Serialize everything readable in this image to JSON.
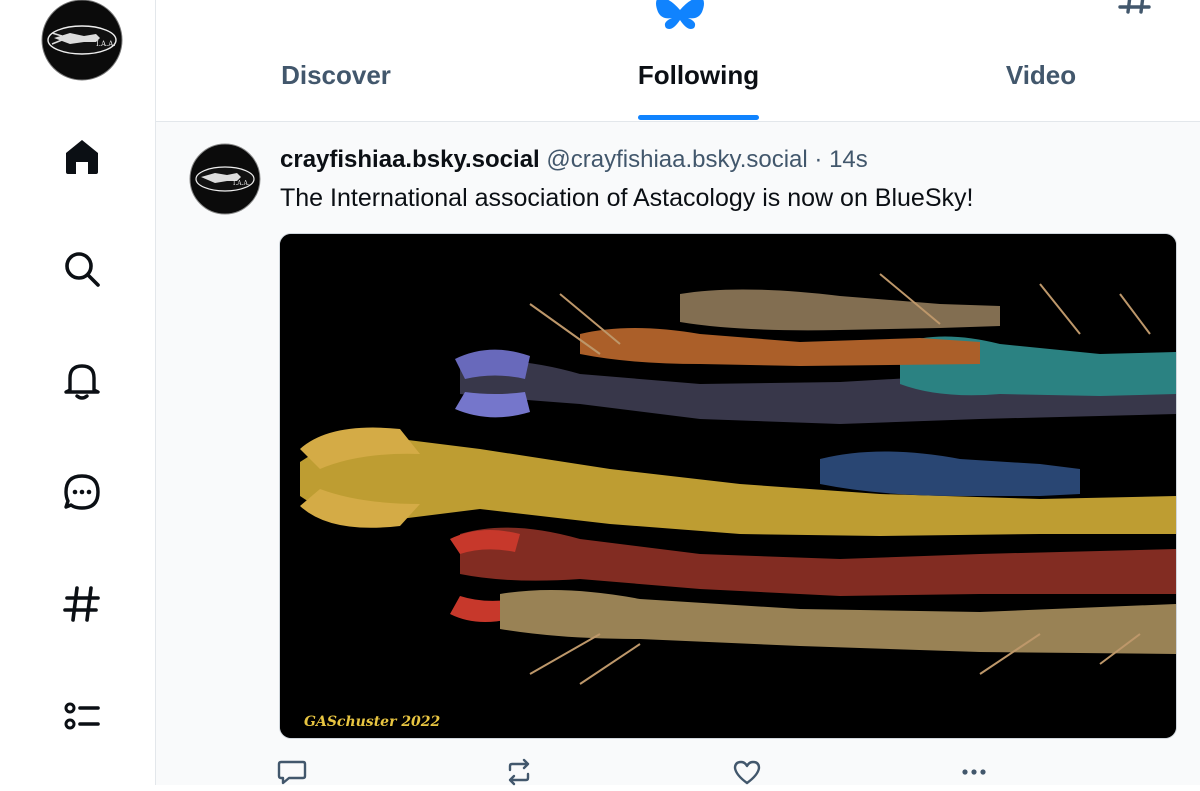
{
  "profile": {
    "logo_text": "I.A.A."
  },
  "nav": [
    {
      "name": "home",
      "icon": "home-icon"
    },
    {
      "name": "search",
      "icon": "search-icon"
    },
    {
      "name": "notifications",
      "icon": "bell-icon"
    },
    {
      "name": "chat",
      "icon": "chat-bubble-icon"
    },
    {
      "name": "feeds",
      "icon": "hashtag-icon"
    },
    {
      "name": "lists",
      "icon": "list-icon"
    }
  ],
  "header": {
    "tabs": [
      {
        "label": "Discover"
      },
      {
        "label": "Following",
        "active": true
      },
      {
        "label": "Video"
      }
    ],
    "accent_color": "#1083fe"
  },
  "post": {
    "display_name": "crayfishiaa.bsky.social",
    "handle": "@crayfishiaa.bsky.social",
    "separator": "·",
    "time": "14s",
    "text": "The International association of Astacology is now on BlueSky!",
    "avatar_text": "I.A.A.",
    "image_signature": "GASchuster 2022",
    "actions": [
      "reply-icon",
      "repost-icon",
      "like-icon",
      "more-icon"
    ]
  }
}
